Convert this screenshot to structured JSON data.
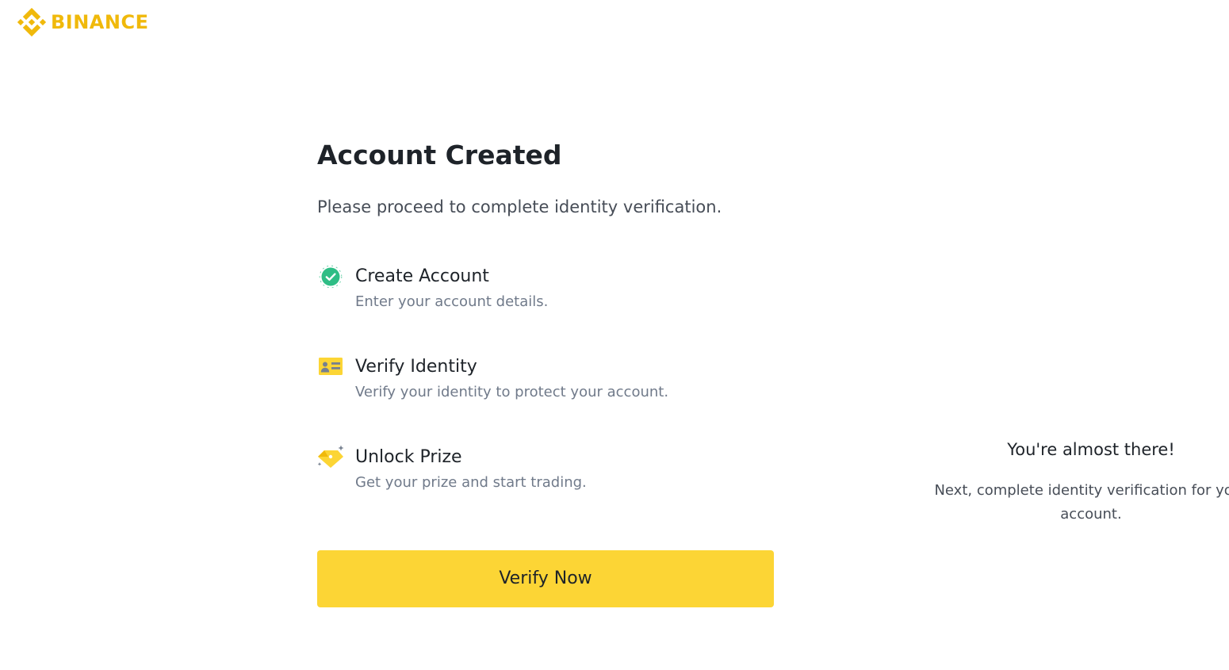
{
  "header": {
    "logo_text": "BINANCE",
    "logo_icon": "binance-logo-icon"
  },
  "main": {
    "title": "Account Created",
    "subtitle": "Please proceed to complete identity verification.",
    "steps": [
      {
        "title": "Create Account",
        "description": "Enter your account details.",
        "icon": "check-circle-icon",
        "status": "completed"
      },
      {
        "title": "Verify Identity",
        "description": "Verify your identity to protect your account.",
        "icon": "id-card-icon"
      },
      {
        "title": "Unlock Prize",
        "description": "Get your prize and start trading.",
        "icon": "prize-tag-icon"
      }
    ],
    "button_label": "Verify Now"
  },
  "side_panel": {
    "title": "You're almost there!",
    "text": "Next, complete identity verification for your account."
  },
  "colors": {
    "brand": "#f0b90b",
    "button": "#fcd535",
    "success": "#2ebd85"
  }
}
